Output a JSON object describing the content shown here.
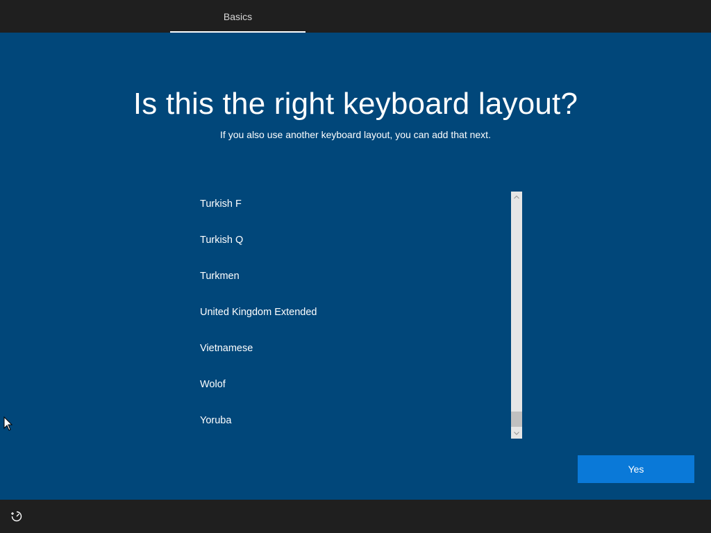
{
  "header": {
    "tabs": [
      {
        "label": "Basics",
        "active": true
      }
    ]
  },
  "main": {
    "title": "Is this the right keyboard layout?",
    "subtitle": "If you also use another keyboard layout, you can add that next.",
    "layouts": [
      "Turkish F",
      "Turkish Q",
      "Turkmen",
      "United Kingdom Extended",
      "Vietnamese",
      "Wolof",
      "Yoruba"
    ],
    "scroll_position": 1.0
  },
  "footer": {
    "yes_label": "Yes",
    "ease_of_access_icon": "ease-of-access-icon"
  },
  "colors": {
    "background": "#01477a",
    "bars": "#1f1f1f",
    "accent": "#0a79d8",
    "scrollbar_track": "#e6e6e6",
    "scrollbar_thumb": "#c0c0c0"
  }
}
